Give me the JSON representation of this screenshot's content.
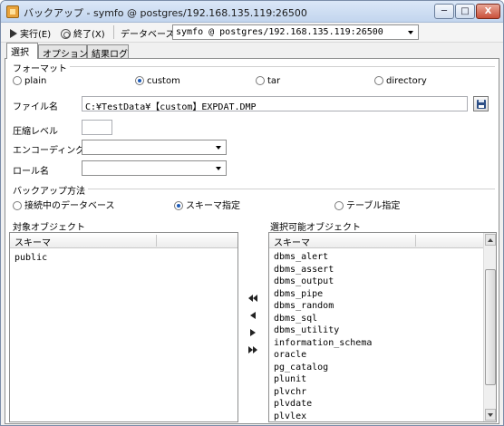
{
  "window": {
    "title": "バックアップ - symfo @ postgres/192.168.135.119:26500",
    "minimize_label": "─",
    "maximize_label": "□",
    "close_label": "X"
  },
  "toolbar": {
    "run_label": "実行(E)",
    "exit_label": "終了(X)",
    "database_label": "データベース",
    "database_value": "symfo @ postgres/192.168.135.119:26500"
  },
  "tabs": [
    {
      "label": "選択"
    },
    {
      "label": "オプション"
    },
    {
      "label": "結果ログ"
    }
  ],
  "format": {
    "group_label": "フォーマット",
    "options": [
      {
        "label": "plain",
        "selected": false
      },
      {
        "label": "custom",
        "selected": true
      },
      {
        "label": "tar",
        "selected": false
      },
      {
        "label": "directory",
        "selected": false
      }
    ]
  },
  "file_name": {
    "label": "ファイル名",
    "value": "C:¥TestData¥【custom】EXPDAT.DMP"
  },
  "compression": {
    "label": "圧縮レベル",
    "value": ""
  },
  "encoding": {
    "label": "エンコーディング",
    "value": ""
  },
  "role": {
    "label": "ロール名",
    "value": ""
  },
  "backup_method": {
    "group_label": "バックアップ方法",
    "options": [
      {
        "label": "接続中のデータベース",
        "selected": false
      },
      {
        "label": "スキーマ指定",
        "selected": true
      },
      {
        "label": "テーブル指定",
        "selected": false
      }
    ]
  },
  "target_objects": {
    "label": "対象オブジェクト",
    "column": "スキーマ",
    "items": [
      "public"
    ]
  },
  "available_objects": {
    "label": "選択可能オブジェクト",
    "column": "スキーマ",
    "items": [
      "dbms_alert",
      "dbms_assert",
      "dbms_output",
      "dbms_pipe",
      "dbms_random",
      "dbms_sql",
      "dbms_utility",
      "information_schema",
      "oracle",
      "pg_catalog",
      "plunit",
      "plvchr",
      "plvdate",
      "plvlex"
    ]
  }
}
